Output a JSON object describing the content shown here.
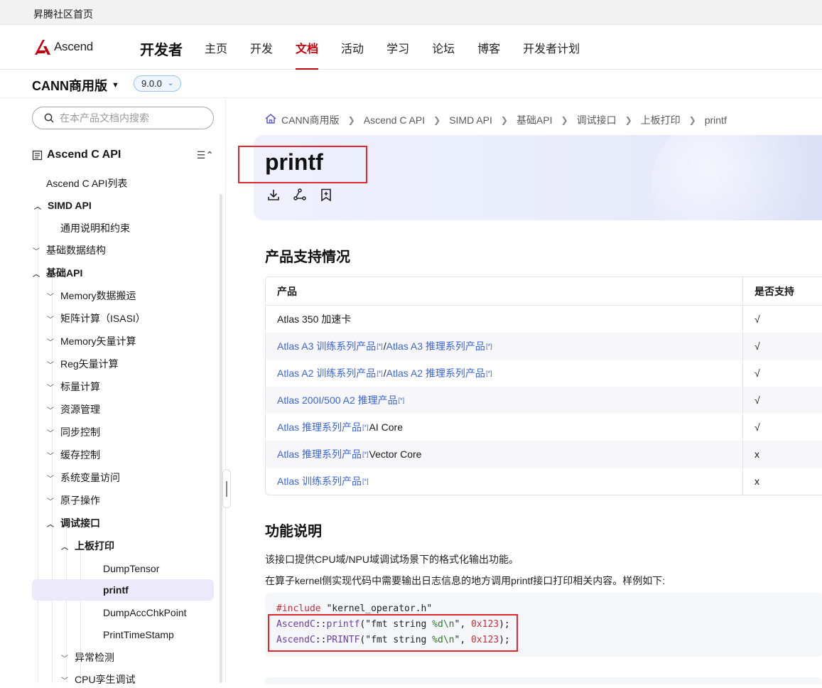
{
  "topbar": {
    "site_home": "昇腾社区首页"
  },
  "header": {
    "logo_text": "Ascend",
    "section_title": "开发者",
    "nav": [
      {
        "label": "主页",
        "active": false
      },
      {
        "label": "开发",
        "active": false
      },
      {
        "label": "文档",
        "active": true
      },
      {
        "label": "活动",
        "active": false
      },
      {
        "label": "学习",
        "active": false
      },
      {
        "label": "论坛",
        "active": false
      },
      {
        "label": "博客",
        "active": false
      },
      {
        "label": "开发者计划",
        "active": false
      }
    ],
    "accent_color": "#c7000b"
  },
  "product_bar": {
    "product": "CANN商用版",
    "version": "9.0.0"
  },
  "sidebar": {
    "search_placeholder": "在本产品文档内搜索",
    "api_title": "Ascend C API",
    "tree": [
      {
        "label": "Ascend C API列表",
        "arrow": ""
      },
      {
        "label": "SIMD API",
        "arrow": "up"
      },
      {
        "label": "通用说明和约束",
        "arrow": ""
      },
      {
        "label": "基础数据结构",
        "arrow": "down"
      },
      {
        "label": "基础API",
        "arrow": "up"
      },
      {
        "label": "Memory数据搬运",
        "arrow": "down"
      },
      {
        "label": "矩阵计算（ISASI）",
        "arrow": "down"
      },
      {
        "label": "Memory矢量计算",
        "arrow": "down"
      },
      {
        "label": "Reg矢量计算",
        "arrow": "down"
      },
      {
        "label": "标量计算",
        "arrow": "down"
      },
      {
        "label": "资源管理",
        "arrow": "down"
      },
      {
        "label": "同步控制",
        "arrow": "down"
      },
      {
        "label": "缓存控制",
        "arrow": "down"
      },
      {
        "label": "系统变量访问",
        "arrow": "down"
      },
      {
        "label": "原子操作",
        "arrow": "down"
      },
      {
        "label": "调试接口",
        "arrow": "up"
      },
      {
        "label": "上板打印",
        "arrow": "up"
      },
      {
        "label": "DumpTensor",
        "arrow": ""
      },
      {
        "label": "printf",
        "arrow": "",
        "selected": true
      },
      {
        "label": "DumpAccChkPoint",
        "arrow": ""
      },
      {
        "label": "PrintTimeStamp",
        "arrow": ""
      },
      {
        "label": "异常检测",
        "arrow": "down"
      },
      {
        "label": "CPU孪生调试",
        "arrow": "down"
      }
    ]
  },
  "breadcrumb": [
    "CANN商用版",
    "Ascend C API",
    "SIMD API",
    "基础API",
    "调试接口",
    "上板打印",
    "printf"
  ],
  "page": {
    "title": "printf",
    "icons": [
      "download-icon",
      "share-icon",
      "bookmark-icon"
    ],
    "support_heading": "产品支持情况",
    "table": {
      "headers": [
        "产品",
        "是否支持"
      ],
      "rows": [
        {
          "parts": [
            {
              "text": "Atlas 350 加速卡",
              "link": false
            }
          ],
          "support": "√"
        },
        {
          "parts": [
            {
              "text": "Atlas A3 训练系列产品",
              "link": true
            },
            {
              "text": "[*]",
              "sup": true
            },
            {
              "text": "/",
              "link": false
            },
            {
              "text": "Atlas A3 推理系列产品",
              "link": true
            },
            {
              "text": "[*]",
              "sup": true
            }
          ],
          "support": "√"
        },
        {
          "parts": [
            {
              "text": "Atlas A2 训练系列产品",
              "link": true
            },
            {
              "text": "[*]",
              "sup": true
            },
            {
              "text": "/",
              "link": false
            },
            {
              "text": "Atlas A2 推理系列产品",
              "link": true
            },
            {
              "text": "[*]",
              "sup": true
            }
          ],
          "support": "√"
        },
        {
          "parts": [
            {
              "text": "Atlas 200I/500 A2 推理产品",
              "link": true
            },
            {
              "text": "[*]",
              "sup": true
            }
          ],
          "support": "√"
        },
        {
          "parts": [
            {
              "text": "Atlas 推理系列产品",
              "link": true
            },
            {
              "text": "[*]",
              "sup": true
            },
            {
              "text": "AI Core",
              "link": false
            }
          ],
          "support": "√"
        },
        {
          "parts": [
            {
              "text": "Atlas 推理系列产品",
              "link": true
            },
            {
              "text": "[*]",
              "sup": true
            },
            {
              "text": "Vector Core",
              "link": false
            }
          ],
          "support": "x"
        },
        {
          "parts": [
            {
              "text": "Atlas 训练系列产品",
              "link": true
            },
            {
              "text": "[*]",
              "sup": true
            }
          ],
          "support": "x"
        }
      ]
    },
    "func_heading": "功能说明",
    "func_para1": "该接口提供CPU域/NPU域调试场景下的格式化输出功能。",
    "func_para2": "在算子kernel侧实现代码中需要输出日志信息的地方调用printf接口打印相关内容。样例如下:",
    "code": {
      "line1_kw": "#include",
      "line1_str": " \"kernel_operator.h\"",
      "line2": {
        "ns": "AscendC",
        "sep": "::",
        "fn": "printf",
        "open": "(",
        "fmt1": "\"fmt string ",
        "spec": "%d\\n",
        "fmt2": "\"",
        "comma": ", ",
        "num": "0x123",
        "close": ");"
      },
      "line3": {
        "ns": "AscendC",
        "sep": "::",
        "fn": "PRINTF",
        "open": "(",
        "fmt1": "\"fmt string ",
        "spec": "%d\\n",
        "fmt2": "\"",
        "comma": ", ",
        "num": "0x123",
        "close": ");"
      }
    }
  }
}
